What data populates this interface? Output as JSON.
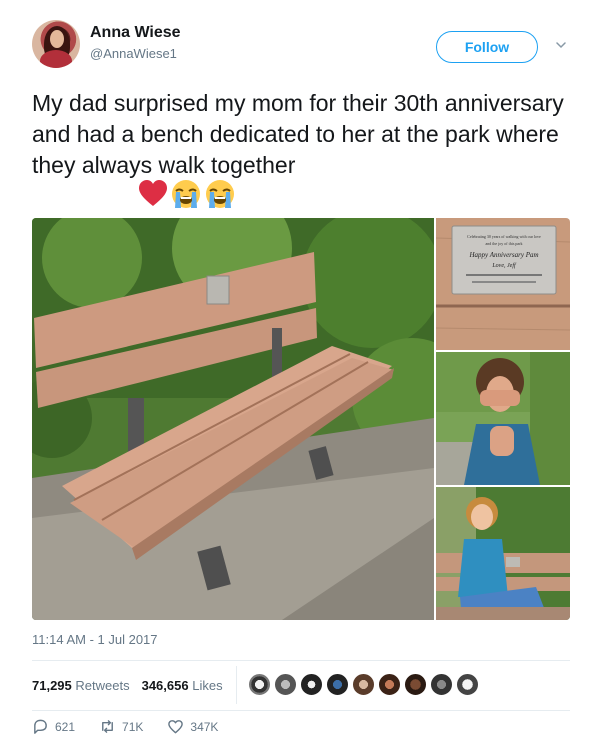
{
  "user": {
    "name": "Anna Wiese",
    "handle": "@AnnaWiese1"
  },
  "follow_label": "Follow",
  "tweet": {
    "text": "My dad surprised my mom for their 30th anniversary and had a bench dedicated to her at the park where they always walk together"
  },
  "plaque": {
    "line1": "Celebrating 30 years of walking with our love",
    "line2": "and the joy of this park",
    "line3": "Happy Anniversary Pam",
    "line4": "Love, Jeff"
  },
  "timestamp": "11:14 AM - 1 Jul 2017",
  "stats": {
    "retweets_count": "71,295",
    "retweets_label": "Retweets",
    "likes_count": "346,656",
    "likes_label": "Likes"
  },
  "actions": {
    "reply_count": "621",
    "retweet_count": "71K",
    "like_count": "347K"
  },
  "colors": {
    "accent": "#1da1f2",
    "heart": "#e0245e"
  }
}
